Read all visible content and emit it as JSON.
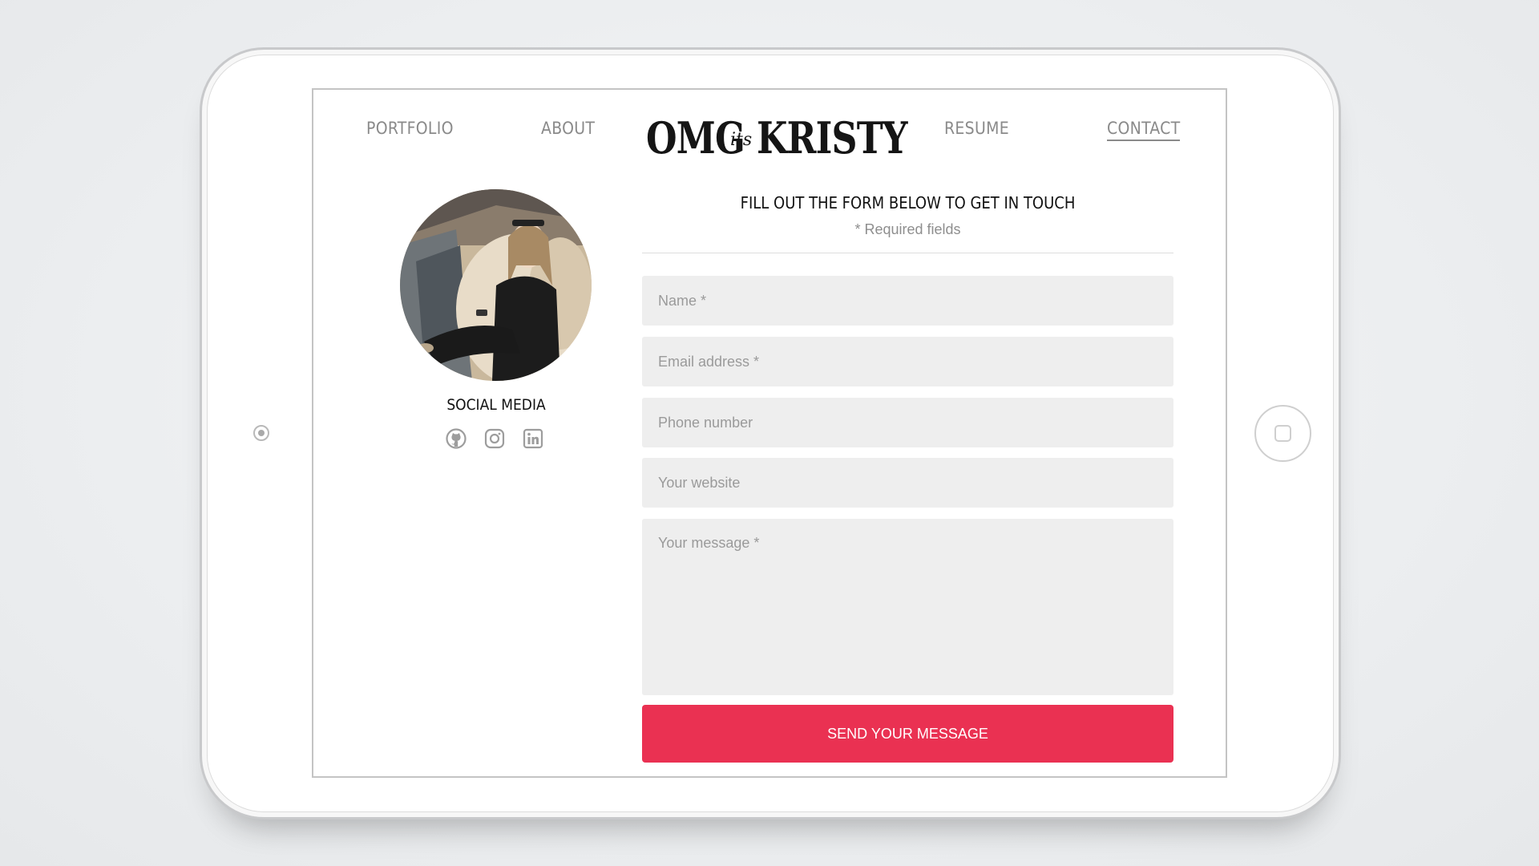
{
  "colors": {
    "accent": "#ea3152",
    "nav_text": "#8a8a8a",
    "field_bg": "#eeeeee"
  },
  "nav": {
    "portfolio": "PORTFOLIO",
    "about": "ABOUT",
    "resume": "RESUME",
    "contact": "CONTACT"
  },
  "logo": {
    "left": "OMG",
    "script": "its",
    "right": "KRISTY"
  },
  "profile": {
    "social_title": "SOCIAL MEDIA",
    "social_icons": [
      "github-icon",
      "instagram-icon",
      "linkedin-icon"
    ]
  },
  "form": {
    "title": "FILL OUT THE FORM BELOW TO GET IN TOUCH",
    "required_note": "* Required fields",
    "name_placeholder": "Name *",
    "email_placeholder": "Email address *",
    "phone_placeholder": "Phone number",
    "website_placeholder": "Your website",
    "message_placeholder": "Your message *",
    "submit_label": "SEND YOUR MESSAGE"
  }
}
